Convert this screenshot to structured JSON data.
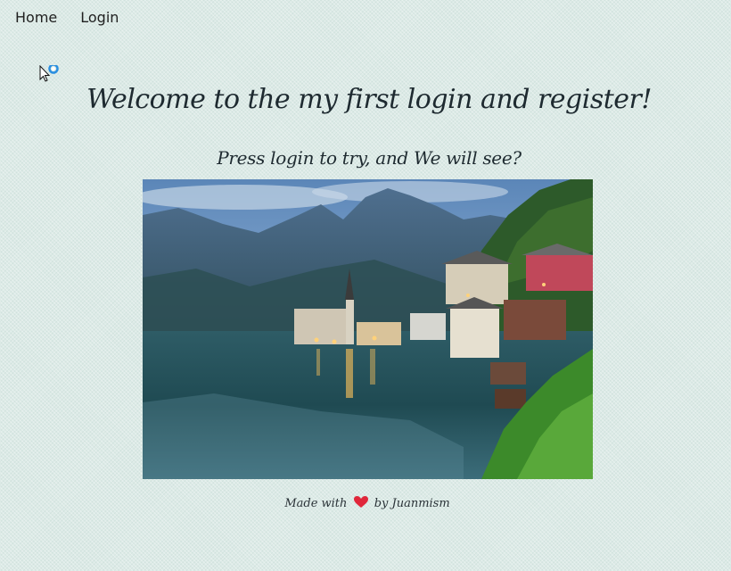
{
  "nav": {
    "items": [
      {
        "label": "Home"
      },
      {
        "label": "Login"
      }
    ]
  },
  "main": {
    "title": "Welcome to the my first login and register!",
    "subtitle": "Press login to try, and We will see?",
    "image_icon": "mountain-lake-village-photo"
  },
  "footer": {
    "made_with": "Made with",
    "by": "by Juanmism",
    "heart_icon": "heart-icon",
    "heart_color": "#e0263a"
  },
  "colors": {
    "background": "#dceae6",
    "text": "#1e2a30"
  }
}
